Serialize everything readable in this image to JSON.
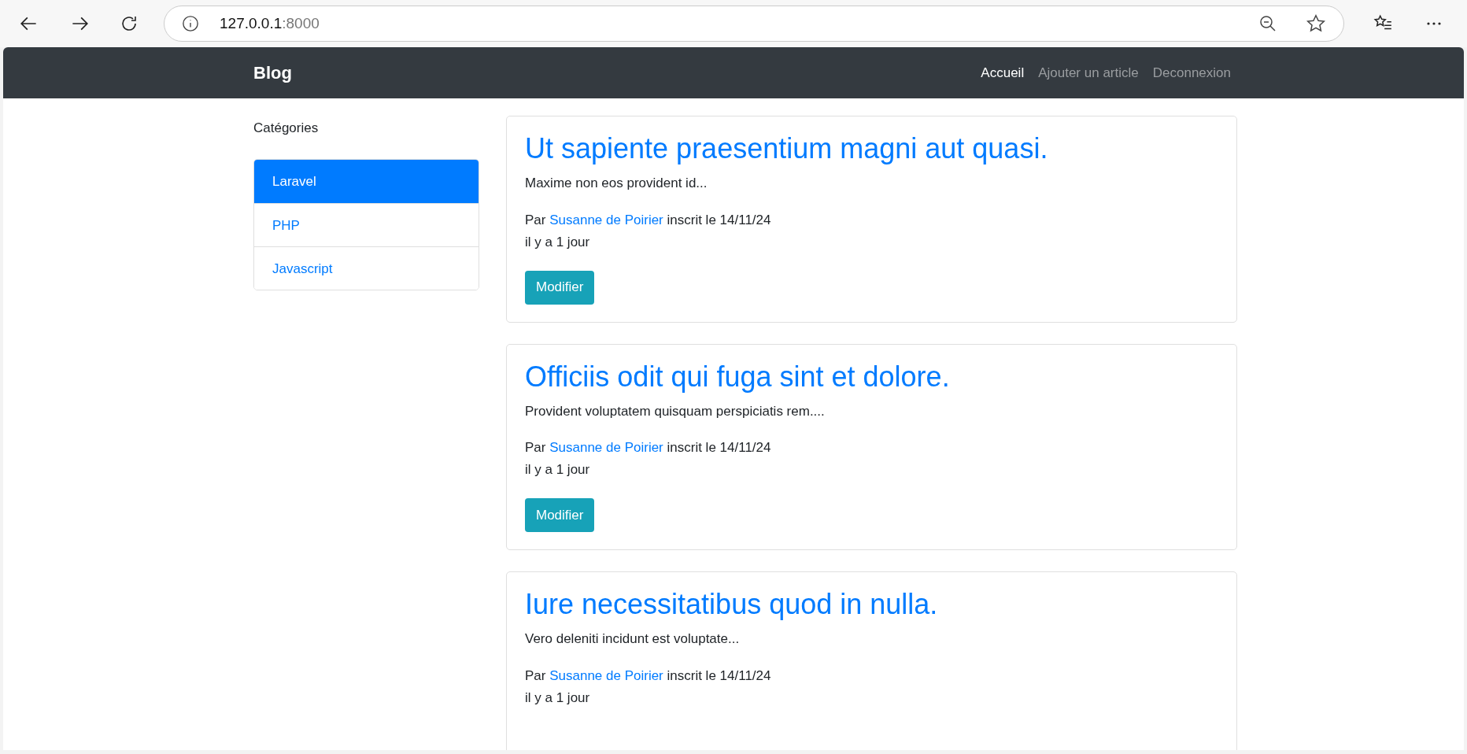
{
  "browser": {
    "url_host": "127.0.0.1",
    "url_port": ":8000"
  },
  "navbar": {
    "brand": "Blog",
    "links": [
      {
        "label": "Accueil",
        "selected": true
      },
      {
        "label": "Ajouter un article",
        "selected": false
      },
      {
        "label": "Deconnexion",
        "selected": false
      }
    ]
  },
  "sidebar": {
    "heading": "Catégories",
    "items": [
      {
        "label": "Laravel",
        "selected": true
      },
      {
        "label": "PHP",
        "selected": false
      },
      {
        "label": "Javascript",
        "selected": false
      }
    ]
  },
  "posts": [
    {
      "title": "Ut sapiente praesentium magni aut quasi.",
      "excerpt": "Maxime non eos provident id...",
      "by": "Par",
      "author": "Susanne de Poirier",
      "registered": "inscrit le 14/11/24",
      "age": "il y a 1 jour",
      "button": "Modifier"
    },
    {
      "title": "Officiis odit qui fuga sint et dolore.",
      "excerpt": "Provident voluptatem quisquam perspiciatis rem....",
      "by": "Par",
      "author": "Susanne de Poirier",
      "registered": "inscrit le 14/11/24",
      "age": "il y a 1 jour",
      "button": "Modifier"
    },
    {
      "title": "Iure necessitatibus quod in nulla.",
      "excerpt": "Vero deleniti incidunt est voluptate...",
      "by": "Par",
      "author": "Susanne de Poirier",
      "registered": "inscrit le 14/11/24",
      "age": "il y a 1 jour"
    }
  ]
}
